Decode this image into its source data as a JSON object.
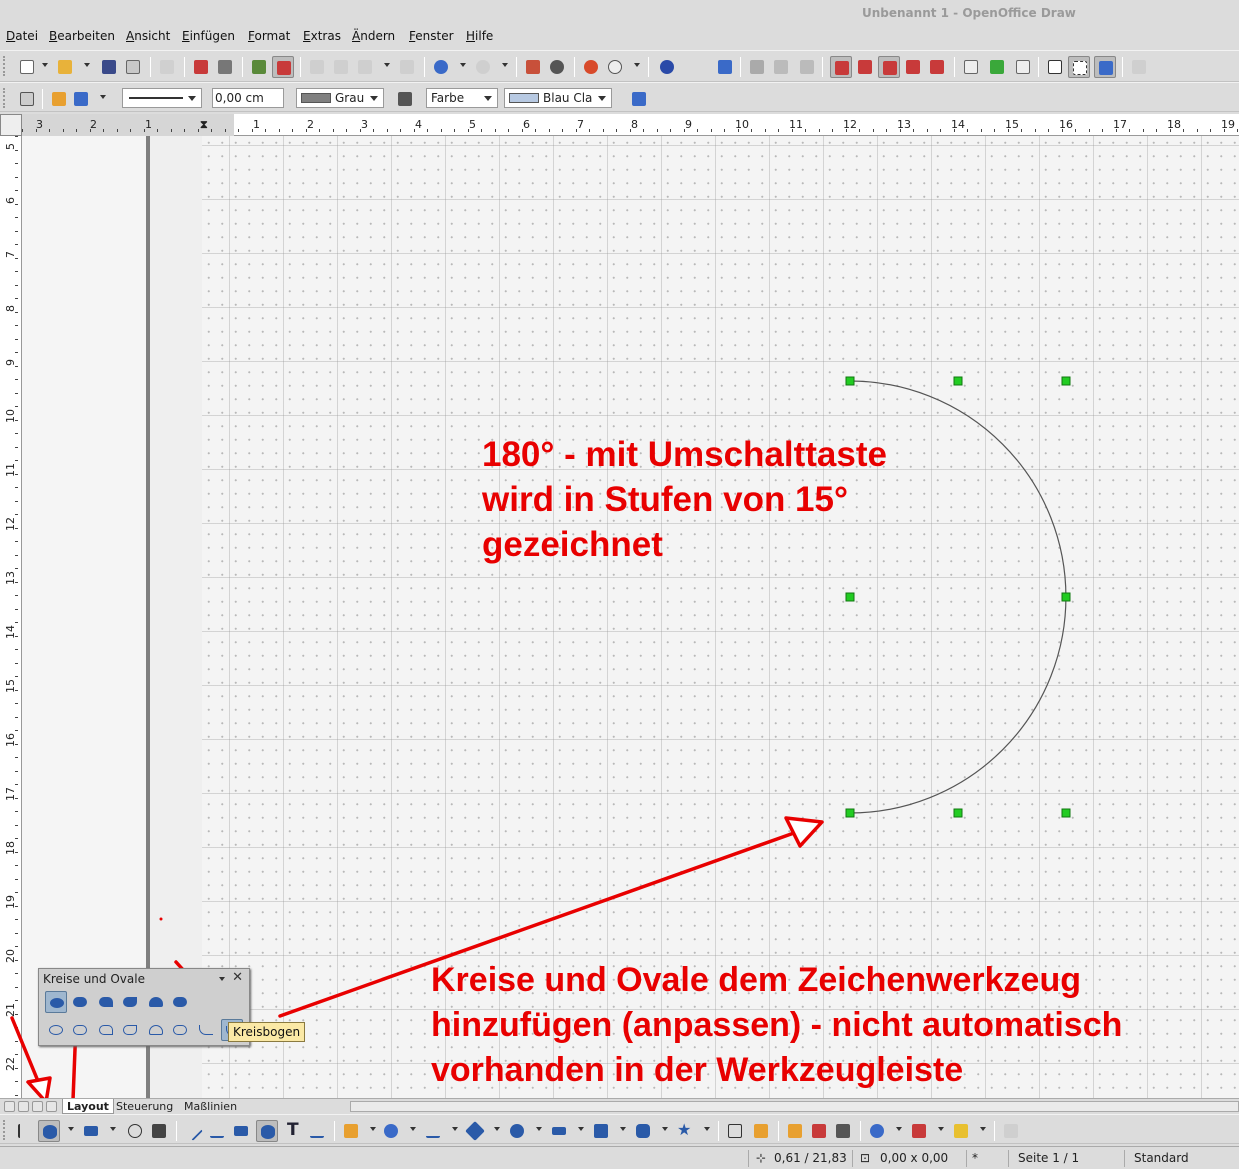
{
  "window": {
    "title": "Unbenannt 1 - OpenOffice Draw"
  },
  "menu": [
    "Datei",
    "Bearbeiten",
    "Ansicht",
    "Einfügen",
    "Format",
    "Extras",
    "Ändern",
    "Fenster",
    "Hilfe"
  ],
  "line_toolbar": {
    "line_width": "0,00 cm",
    "line_color": "Grau",
    "area_style": "Farbe",
    "area_color": "Blau Cla",
    "colors": {
      "grau": "#808080",
      "blau": "#b7c9e2"
    }
  },
  "ruler": {
    "horizontal_labels": [
      "3",
      "2",
      "1",
      "1",
      "2",
      "3",
      "4",
      "5",
      "6",
      "7",
      "8",
      "9",
      "10",
      "11",
      "12",
      "13",
      "14",
      "15",
      "16",
      "17",
      "18",
      "19"
    ],
    "vertical_labels": [
      "5",
      "6",
      "7",
      "8",
      "9",
      "10",
      "11",
      "12",
      "13",
      "14",
      "15",
      "16",
      "17",
      "18",
      "19",
      "20",
      "21",
      "22"
    ]
  },
  "annotations": {
    "top_line1": "180° - mit Umschalttaste",
    "top_line2": "wird in Stufen von 15°",
    "top_line3": "gezeichnet",
    "bottom_line1": "Kreise und Ovale dem Zeichenwerkzeug",
    "bottom_line2": "hinzufügen (anpassen) - nicht automatisch",
    "bottom_line3": "vorhanden in der Werkzeugleiste",
    "color": "#e80000"
  },
  "shape": {
    "type": "circular-arc",
    "angle": "180°",
    "handle_color": "#22cc22"
  },
  "panel": {
    "title": "Kreise und Ovale",
    "tooltip": "Kreisbogen"
  },
  "tabs": [
    "Layout",
    "Steuerung",
    "Maßlinien"
  ],
  "status": {
    "position": "0,61 / 21,83",
    "size": "0,00 x 0,00",
    "modified": "*",
    "page": "Seite 1 / 1",
    "style": "Standard"
  }
}
